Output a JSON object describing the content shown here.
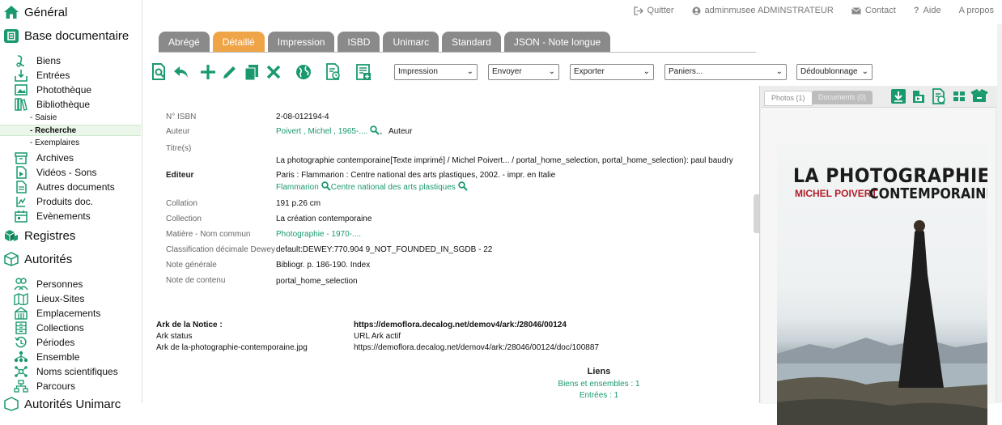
{
  "sidebar": {
    "general": "Général",
    "base": "Base documentaire",
    "items": [
      {
        "label": "Biens"
      },
      {
        "label": "Entrées"
      },
      {
        "label": "Photothèque"
      },
      {
        "label": "Bibliothèque"
      }
    ],
    "subitems": [
      {
        "label": "- Saisie"
      },
      {
        "label": "- Recherche"
      },
      {
        "label": "- Exemplaires"
      }
    ],
    "items2": [
      {
        "label": "Archives"
      },
      {
        "label": "Vidéos - Sons"
      },
      {
        "label": "Autres documents"
      },
      {
        "label": "Produits doc."
      },
      {
        "label": "Evènements"
      }
    ],
    "registres": "Registres",
    "autorites": "Autorités",
    "items3": [
      {
        "label": "Personnes"
      },
      {
        "label": "Lieux-Sites"
      },
      {
        "label": "Emplacements"
      },
      {
        "label": "Collections"
      },
      {
        "label": "Périodes"
      },
      {
        "label": "Ensemble"
      },
      {
        "label": "Noms scientifiques"
      },
      {
        "label": "Parcours"
      }
    ],
    "autorites_unimarc": "Autorités Unimarc"
  },
  "toplinks": {
    "quit": "Quitter",
    "user": "adminmusee ADMINSTRATEUR",
    "contact": "Contact",
    "help": "Aide",
    "about": "A propos"
  },
  "tabs": [
    "Abrégé",
    "Détaillé",
    "Impression",
    "ISBD",
    "Unimarc",
    "Standard",
    "JSON - Note longue"
  ],
  "selects": {
    "impression": "Impression",
    "envoyer": "Envoyer",
    "exporter": "Exporter",
    "paniers": "Paniers...",
    "dedoublonnage": "Dédoublonnage"
  },
  "record": {
    "isbn_label": "N° ISBN",
    "isbn": "2-08-012194-4",
    "auteur_label": "Auteur",
    "auteur_link": "Poivert , Michel , 1965-....",
    "auteur_role": ",   Auteur",
    "titre_label": "Titre(s)",
    "titre": "La photographie contemporaine[Texte imprimé] / Michel Poivert... / portal_home_selection, portal_home_selection): paul baudry",
    "editeur_label": "Editeur",
    "editeur": "Paris : Flammarion : Centre national des arts plastiques, 2002. - impr. en Italie",
    "editeur_link1": "Flammarion",
    "editeur_link2": "Centre national des arts plastiques",
    "collation_label": "Collation",
    "collation": "191 p.26 cm",
    "collection_label": "Collection",
    "collection": "La création contemporaine",
    "matiere_label": "Matière - Nom commun",
    "matiere_link1": "Photographie",
    "matiere_sep": " - ",
    "matiere_link2": "1970-....",
    "dewey_label": "Classification décimale Dewey",
    "dewey": "default:DEWEY:770.904 9_NOT_FOUNDED_IN_SGDB - 22",
    "note_label": "Note générale",
    "note": "Bibliogr. p. 186-190. Index",
    "contenu_label": "Note de contenu",
    "contenu": "portal_home_selection"
  },
  "ark": {
    "title": "Ark de la Notice :",
    "url": "https://demoflora.decalog.net/demov4/ark:/28046/00124",
    "status_label": "Ark status",
    "status": "URL Ark actif",
    "file_label": "Ark de la-photographie-contemporaine.jpg",
    "file_url": "https://demoflora.decalog.net/demov4/ark:/28046/00124/doc/100887"
  },
  "liens": {
    "title": "Liens",
    "biens": "Biens et ensembles : 1",
    "entrees": "Entrées : 1"
  },
  "panel": {
    "tab_photos": "Photos (1)",
    "tab_documents": "Documents (0)"
  },
  "cover": {
    "title1": "LA PHOTOGRAPHIE",
    "author": "MICHEL POIVERT",
    "title2": "CONTEMPORAINE"
  },
  "colors": {
    "accent": "#1a9a6c",
    "tab_active": "#f0a448",
    "tab": "#8a8a8a",
    "author_red": "#b21e2a"
  }
}
